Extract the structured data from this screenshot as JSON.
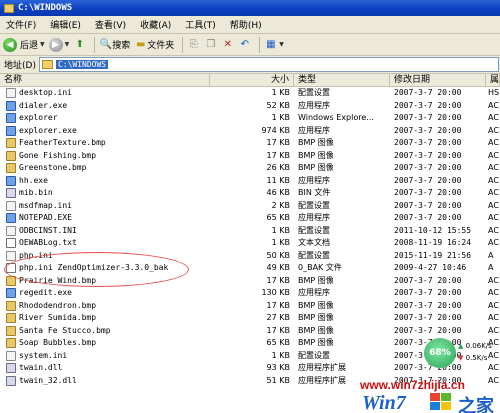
{
  "window": {
    "title": "C:\\WINDOWS"
  },
  "menu": [
    "文件(F)",
    "编辑(E)",
    "查看(V)",
    "收藏(A)",
    "工具(T)",
    "帮助(H)"
  ],
  "toolbar": {
    "back_label": "后退",
    "search_label": "搜索",
    "folders_label": "文件夹"
  },
  "address": {
    "label": "地址(D)",
    "path": "C:\\WINDOWS"
  },
  "columns": {
    "name": "名称",
    "size": "大小",
    "type": "类型",
    "date": "修改日期",
    "attr": "属"
  },
  "files": [
    {
      "icon": "ini",
      "name": "desktop.ini",
      "size": "1 KB",
      "type": "配置设置",
      "date": "2007-3-7 20:00",
      "attr": "HS"
    },
    {
      "icon": "exe",
      "name": "dialer.exe",
      "size": "52 KB",
      "type": "应用程序",
      "date": "2007-3-7 20:00",
      "attr": "AC"
    },
    {
      "icon": "exe",
      "name": "explorer",
      "size": "1 KB",
      "type": "Windows Explore...",
      "date": "2007-3-7 20:00",
      "attr": "AC"
    },
    {
      "icon": "exe",
      "name": "explorer.exe",
      "size": "974 KB",
      "type": "应用程序",
      "date": "2007-3-7 20:00",
      "attr": "AC"
    },
    {
      "icon": "bmp",
      "name": "FeatherTexture.bmp",
      "size": "17 KB",
      "type": "BMP 图像",
      "date": "2007-3-7 20:00",
      "attr": "AC"
    },
    {
      "icon": "bmp",
      "name": "Gone Fishing.bmp",
      "size": "17 KB",
      "type": "BMP 图像",
      "date": "2007-3-7 20:00",
      "attr": "AC"
    },
    {
      "icon": "bmp",
      "name": "Greenstone.bmp",
      "size": "26 KB",
      "type": "BMP 图像",
      "date": "2007-3-7 20:00",
      "attr": "AC"
    },
    {
      "icon": "exe",
      "name": "hh.exe",
      "size": "11 KB",
      "type": "应用程序",
      "date": "2007-3-7 20:00",
      "attr": "AC"
    },
    {
      "icon": "dll",
      "name": "mib.bin",
      "size": "46 KB",
      "type": "BIN 文件",
      "date": "2007-3-7 20:00",
      "attr": "AC"
    },
    {
      "icon": "ini",
      "name": "msdfmap.ini",
      "size": "2 KB",
      "type": "配置设置",
      "date": "2007-3-7 20:00",
      "attr": "AC"
    },
    {
      "icon": "exe",
      "name": "NOTEPAD.EXE",
      "size": "65 KB",
      "type": "应用程序",
      "date": "2007-3-7 20:00",
      "attr": "AC"
    },
    {
      "icon": "ini",
      "name": "ODBCINST.INI",
      "size": "1 KB",
      "type": "配置设置",
      "date": "2011-10-12 15:55",
      "attr": "AC"
    },
    {
      "icon": "txt",
      "name": "OEWABLog.txt",
      "size": "1 KB",
      "type": "文本文档",
      "date": "2008-11-19 16:24",
      "attr": "AC"
    },
    {
      "icon": "ini",
      "name": "php.ini",
      "size": "50 KB",
      "type": "配置设置",
      "date": "2015-11-19 21:56",
      "attr": "A"
    },
    {
      "icon": "txt",
      "name": "php.ini ZendOptimizer-3.3.0_bak",
      "size": "49 KB",
      "type": "0_BAK 文件",
      "date": "2009-4-27 10:46",
      "attr": "A"
    },
    {
      "icon": "bmp",
      "name": "Prairie Wind.bmp",
      "size": "17 KB",
      "type": "BMP 图像",
      "date": "2007-3-7 20:00",
      "attr": "AC"
    },
    {
      "icon": "exe",
      "name": "regedit.exe",
      "size": "130 KB",
      "type": "应用程序",
      "date": "2007-3-7 20:00",
      "attr": "AC"
    },
    {
      "icon": "bmp",
      "name": "Rhododendron.bmp",
      "size": "17 KB",
      "type": "BMP 图像",
      "date": "2007-3-7 20:00",
      "attr": "AC"
    },
    {
      "icon": "bmp",
      "name": "River Sumida.bmp",
      "size": "27 KB",
      "type": "BMP 图像",
      "date": "2007-3-7 20:00",
      "attr": "AC"
    },
    {
      "icon": "bmp",
      "name": "Santa Fe Stucco.bmp",
      "size": "17 KB",
      "type": "BMP 图像",
      "date": "2007-3-7 20:00",
      "attr": "AC"
    },
    {
      "icon": "bmp",
      "name": "Soap Bubbles.bmp",
      "size": "65 KB",
      "type": "BMP 图像",
      "date": "2007-3-7 20:00",
      "attr": "AC"
    },
    {
      "icon": "ini",
      "name": "system.ini",
      "size": "1 KB",
      "type": "配置设置",
      "date": "2007-3-7 20:00",
      "attr": "AC"
    },
    {
      "icon": "dll",
      "name": "twain.dll",
      "size": "93 KB",
      "type": "应用程序扩展",
      "date": "2007-3-7 20:00",
      "attr": "AC"
    },
    {
      "icon": "dll",
      "name": "twain_32.dll",
      "size": "51 KB",
      "type": "应用程序扩展",
      "date": "2007-3-7 20:00",
      "attr": "AC"
    }
  ],
  "netmonitor": {
    "percent": "68%",
    "upload": "0.06K/s",
    "download": "0.5K/s"
  },
  "watermark": {
    "url": "www.win7zhijia.cn",
    "logo": "Win7",
    "cn": "之家"
  },
  "colors": {
    "titlebar": "#0a3fbf",
    "selection": "#316ac5",
    "annotation": "#e25050"
  }
}
